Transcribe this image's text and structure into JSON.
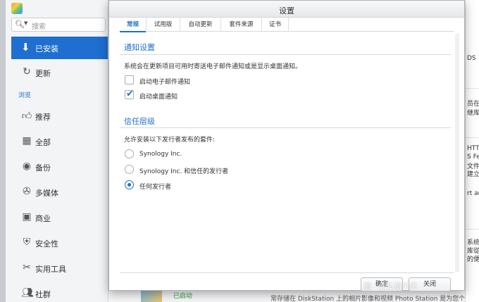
{
  "sidebar": {
    "search_placeholder": "搜索",
    "active_item": "已安装",
    "update_item": "更新",
    "section": "浏览",
    "items": [
      "推荐",
      "全部",
      "备份",
      "多媒体",
      "商业",
      "安全性",
      "实用工具",
      "社群"
    ]
  },
  "dialog": {
    "title": "设置",
    "tabs": [
      "常规",
      "试用版",
      "自动更新",
      "套件来源",
      "证书"
    ],
    "notify": {
      "title": "通知设置",
      "desc": "系统会在更新项目可用时寄送电子邮件通知或是显示桌面通知。",
      "email_label": "启动电子邮件通知",
      "email_checked": false,
      "desktop_label": "启动桌面通知",
      "desktop_checked": true
    },
    "trust": {
      "title": "信任层级",
      "desc": "允许安装以下发行者发布的套件:",
      "options": [
        "Synology Inc.",
        "Synology Inc. 和信任的发行者",
        "任何发行者"
      ],
      "selected": 2
    },
    "ok_label": "确定",
    "close_label": "关闭"
  },
  "background": {
    "right_fragments": [
      "DS",
      "员在",
      "继库,",
      "HTT",
      "S Fe",
      "文件至",
      "建立",
      "rt an",
      "系统",
      "库從",
      "的便"
    ],
    "started_label": "已启动",
    "bottom_desc": "常存储在 DiskStation 上的相片影像和视频   Photo Station 是为您个人"
  },
  "watermark": "值 · 什么值得买",
  "colors": {
    "accent": "#1e6fd0"
  }
}
